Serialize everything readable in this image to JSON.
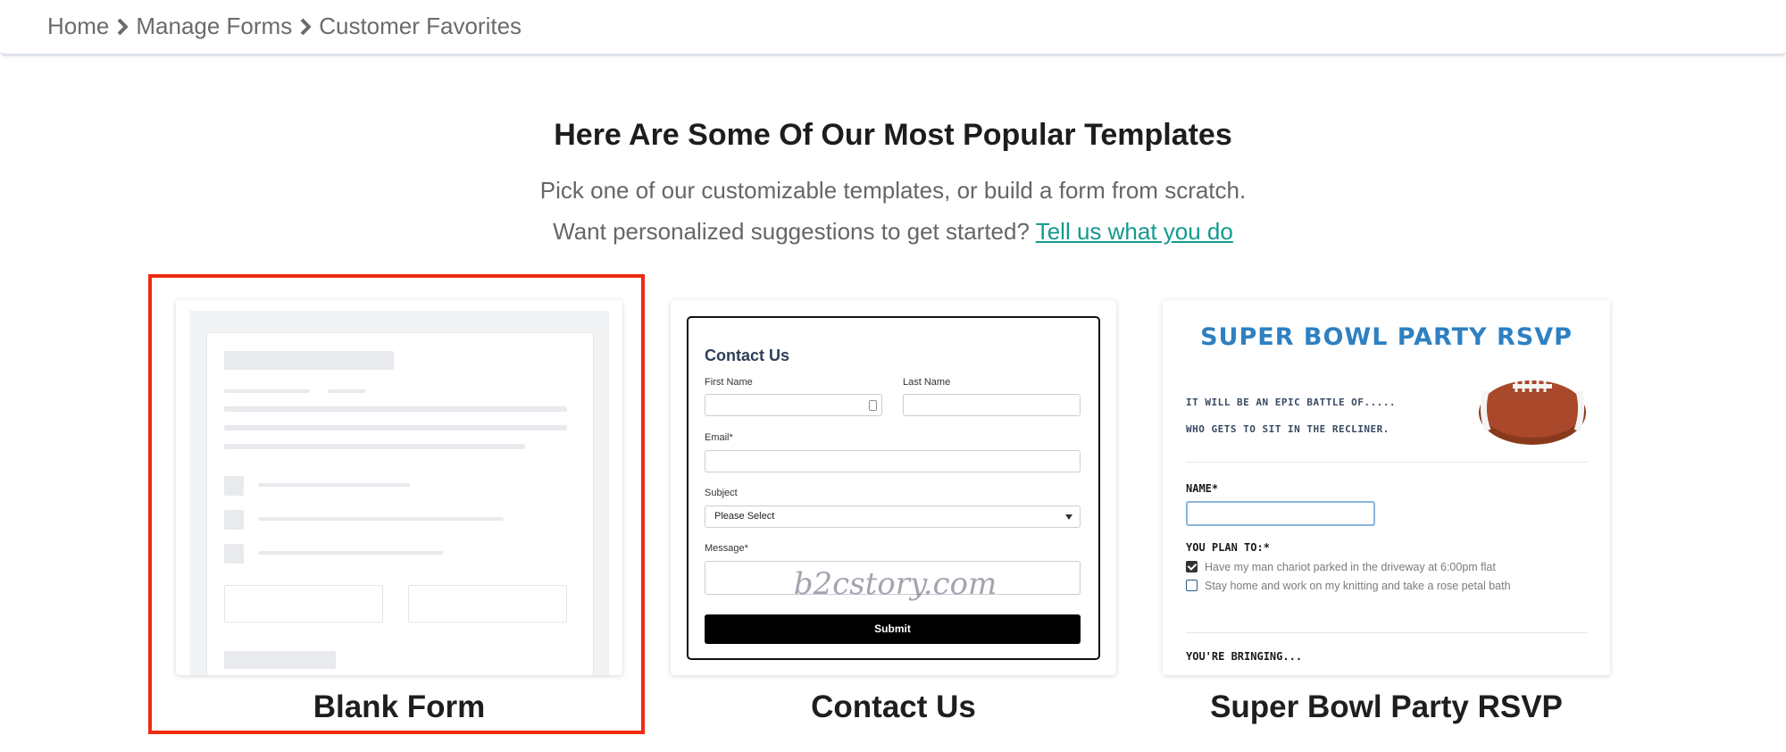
{
  "breadcrumb": {
    "items": [
      "Home",
      "Manage Forms"
    ],
    "current": "Customer Favorites"
  },
  "main": {
    "heading": "Here Are Some Of Our Most Popular Templates",
    "subtitle": "Pick one of our customizable templates, or build a form from scratch.",
    "suggestion_prefix": "Want personalized suggestions to get started?",
    "suggestion_link": "Tell us what you do"
  },
  "templates": [
    {
      "title": "Blank Form",
      "selected": true
    },
    {
      "title": "Contact Us",
      "selected": false
    },
    {
      "title": "Super Bowl Party RSVP",
      "selected": false
    }
  ],
  "contact_preview": {
    "title": "Contact Us",
    "first_name_label": "First Name",
    "last_name_label": "Last Name",
    "email_label": "Email*",
    "subject_label": "Subject",
    "subject_value": "Please Select",
    "message_label": "Message*",
    "submit_label": "Submit",
    "watermark": "b2cstory.com"
  },
  "rsvp_preview": {
    "title": "SUPER BOWL PARTY RSVP",
    "line1": "IT WILL BE AN EPIC BATTLE OF.....",
    "line2": "WHO GETS TO SIT IN THE RECLINER.",
    "name_label": "NAME*",
    "plan_label": "YOU PLAN TO:*",
    "option1": "Have my man chariot parked in the driveway at 6:00pm flat",
    "option1_checked": true,
    "option2": "Stay home and work on my knitting and take a rose petal bath",
    "option2_checked": false,
    "bringing_label": "YOU'RE BRINGING..."
  },
  "colors": {
    "link": "#139a8e",
    "selection": "#ee2b10",
    "rsvp_title": "#2e80c1"
  }
}
